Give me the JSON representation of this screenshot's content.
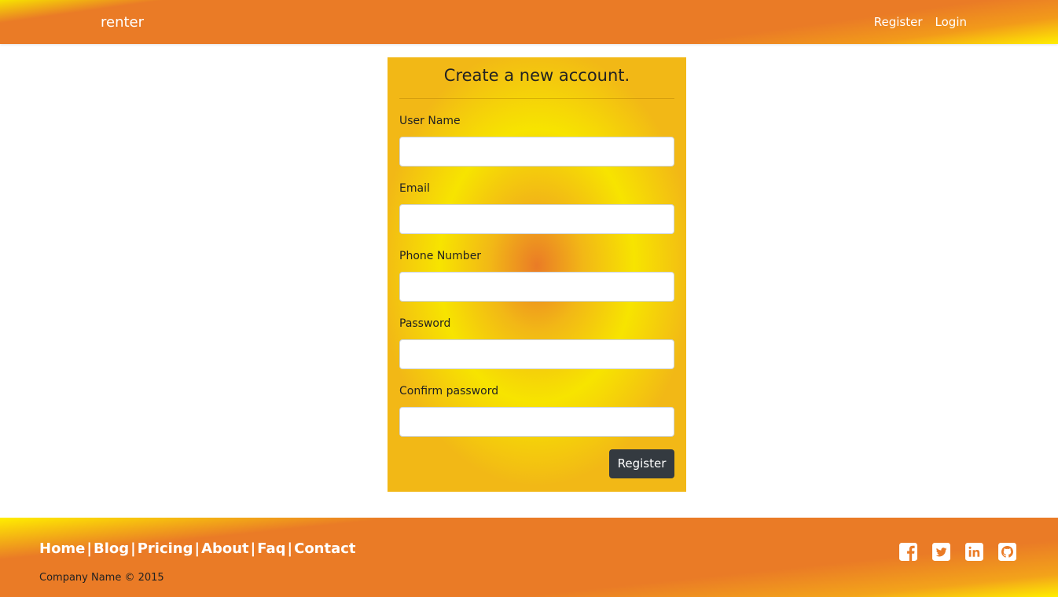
{
  "header": {
    "brand": "renter",
    "nav": {
      "register_label": "Register",
      "login_label": "Login"
    }
  },
  "form": {
    "title": "Create a new account.",
    "fields": [
      {
        "label": "User Name",
        "value": ""
      },
      {
        "label": "Email",
        "value": ""
      },
      {
        "label": "Phone Number",
        "value": ""
      },
      {
        "label": "Password",
        "value": ""
      },
      {
        "label": "Confirm password",
        "value": ""
      }
    ],
    "submit_label": "Register"
  },
  "footer": {
    "links": [
      "Home",
      "Blog",
      "Pricing",
      "About",
      "Faq",
      "Contact"
    ],
    "separator": "|",
    "copyright": "Company Name © 2015",
    "social_icons": [
      "facebook-icon",
      "twitter-icon",
      "linkedin-icon",
      "github-icon"
    ]
  },
  "colors": {
    "orange": "#ea7b26",
    "yellow": "#f7e400",
    "button_dark": "#343a40"
  }
}
